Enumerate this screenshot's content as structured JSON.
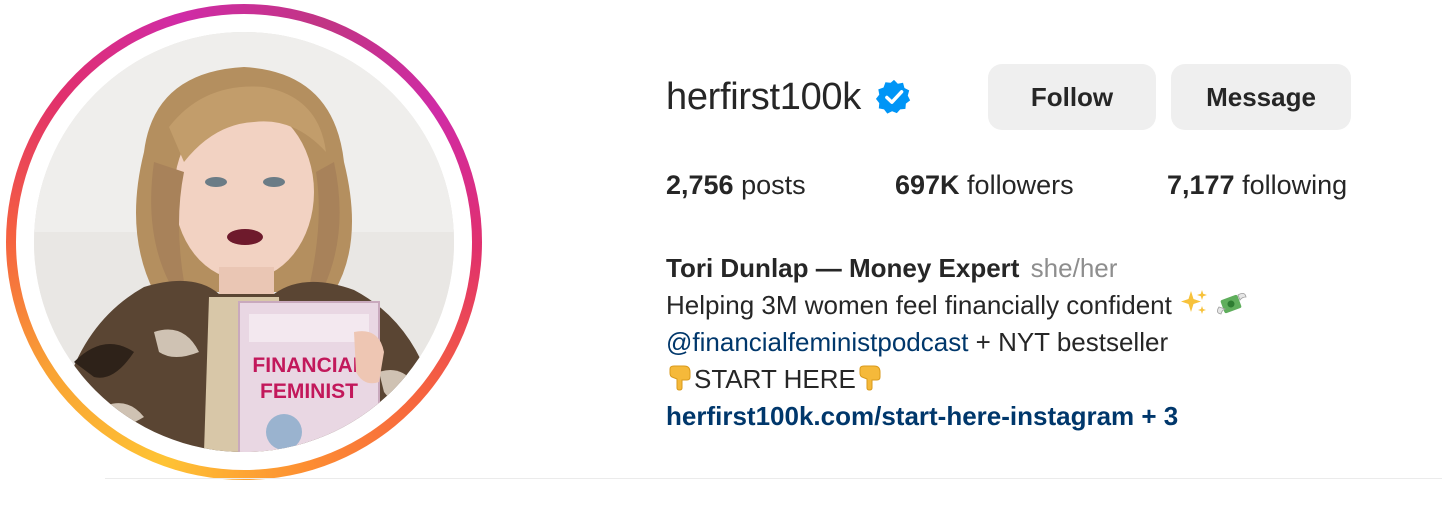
{
  "profile": {
    "username": "herfirst100k",
    "verified": true,
    "actions": {
      "follow_label": "Follow",
      "message_label": "Message"
    },
    "stats": {
      "posts_count": "2,756",
      "posts_label": " posts",
      "followers_count": "697K",
      "followers_label": " followers",
      "following_count": "7,177",
      "following_label": " following"
    },
    "bio": {
      "full_name": "Tori Dunlap — Money Expert",
      "pronouns": "she/her",
      "line1": "Helping 3M women feel financially confident",
      "line1_emojis": [
        "sparkles-icon",
        "money-with-wings-icon"
      ],
      "mention": "@financialfeministpodcast",
      "line2_rest": " + NYT bestseller",
      "start_here": "START HERE",
      "start_here_emoji": "pointing-down-hand-icon",
      "link": "herfirst100k.com/start-here-instagram + 3"
    },
    "avatar": {
      "book_title_line1": "FINANCIAL",
      "book_title_line2": "FEMINIST"
    }
  },
  "colors": {
    "text_primary": "#262626",
    "text_secondary": "#8e8e8e",
    "link": "#00376b",
    "button_bg": "#efefef",
    "verified_blue": "#0095f6",
    "ring_gradient": [
      "#fec334",
      "#f56040",
      "#e1306c",
      "#c13584"
    ]
  }
}
